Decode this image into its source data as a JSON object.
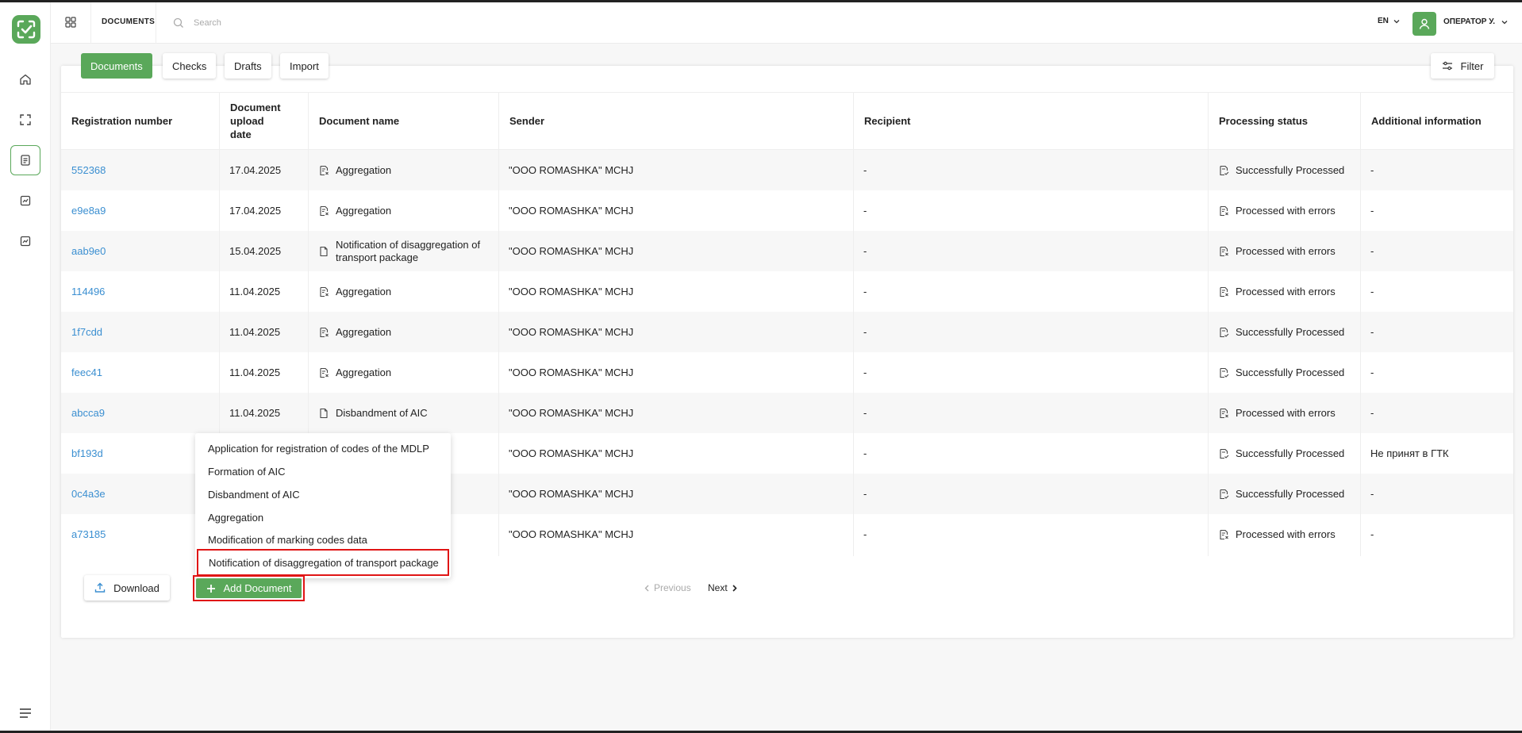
{
  "header": {
    "section_title": "DOCUMENTS",
    "search_placeholder": "Search",
    "language": "EN",
    "user_name": "ОПЕРАТОР У."
  },
  "sidebar": {
    "items": [
      "home-icon",
      "scan-icon",
      "documents-icon",
      "check-icon",
      "check-alt-icon"
    ]
  },
  "tabs": [
    {
      "label": "Documents",
      "active": true
    },
    {
      "label": "Checks",
      "active": false
    },
    {
      "label": "Drafts",
      "active": false
    },
    {
      "label": "Import",
      "active": false
    }
  ],
  "filter_label": "Filter",
  "table": {
    "columns": [
      "Registration number",
      "Document upload date",
      "Document name",
      "Sender",
      "Recipient",
      "Processing status",
      "Additional information"
    ],
    "rows": [
      {
        "reg": "552368",
        "date": "17.04.2025",
        "name": "Aggregation",
        "sender": "\"OOO ROMASHKA\" MCHJ",
        "recipient": "-",
        "status": "Successfully Processed",
        "info": "-"
      },
      {
        "reg": "e9e8a9",
        "date": "17.04.2025",
        "name": "Aggregation",
        "sender": "\"OOO ROMASHKA\" MCHJ",
        "recipient": "-",
        "status": "Processed with errors",
        "info": "-"
      },
      {
        "reg": "aab9e0",
        "date": "15.04.2025",
        "name": "Notification of disaggregation of transport package",
        "sender": "\"OOO ROMASHKA\" MCHJ",
        "recipient": "-",
        "status": "Processed with errors",
        "info": "-"
      },
      {
        "reg": "114496",
        "date": "11.04.2025",
        "name": "Aggregation",
        "sender": "\"OOO ROMASHKA\" MCHJ",
        "recipient": "-",
        "status": "Processed with errors",
        "info": "-"
      },
      {
        "reg": "1f7cdd",
        "date": "11.04.2025",
        "name": "Aggregation",
        "sender": "\"OOO ROMASHKA\" MCHJ",
        "recipient": "-",
        "status": "Successfully Processed",
        "info": "-"
      },
      {
        "reg": "feec41",
        "date": "11.04.2025",
        "name": "Aggregation",
        "sender": "\"OOO ROMASHKA\" MCHJ",
        "recipient": "-",
        "status": "Successfully Processed",
        "info": "-"
      },
      {
        "reg": "abcca9",
        "date": "11.04.2025",
        "name": "Disbandment of AIC",
        "sender": "\"OOO ROMASHKA\" MCHJ",
        "recipient": "-",
        "status": "Processed with errors",
        "info": "-"
      },
      {
        "reg": "bf193d",
        "date": "",
        "name": "",
        "sender": "\"OOO ROMASHKA\" MCHJ",
        "recipient": "-",
        "status": "Successfully Processed",
        "info": "Не принят в ГТК"
      },
      {
        "reg": "0c4a3e",
        "date": "",
        "name": "",
        "sender": "\"OOO ROMASHKA\" MCHJ",
        "recipient": "-",
        "status": "Successfully Processed",
        "info": "-"
      },
      {
        "reg": "a73185",
        "date": "",
        "name": "",
        "sender": "\"OOO ROMASHKA\" MCHJ",
        "recipient": "-",
        "status": "Processed with errors",
        "info": "-"
      }
    ]
  },
  "dropdown": {
    "items": [
      "Application for registration of codes of the MDLP",
      "Formation of AIC",
      "Disbandment of AIC",
      "Aggregation",
      "Modification of marking codes data",
      "Notification of disaggregation of transport package"
    ],
    "highlighted_index": 5
  },
  "footer": {
    "download_label": "Download",
    "add_document_label": "Add Document",
    "previous_label": "Previous",
    "next_label": "Next"
  },
  "colors": {
    "accent": "#5aa85a",
    "link": "#3b8fd1",
    "highlight": "#e01515"
  }
}
